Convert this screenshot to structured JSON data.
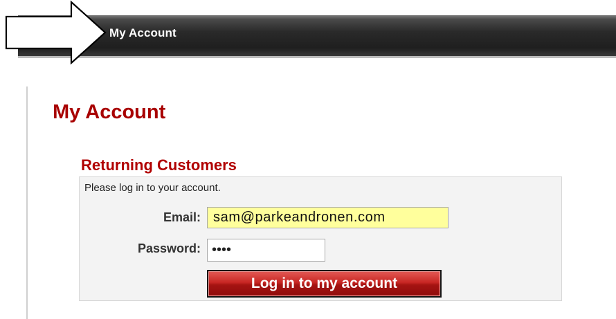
{
  "header": {
    "title": "My Account"
  },
  "page": {
    "title": "My Account"
  },
  "login": {
    "heading": "Returning Customers",
    "intro": "Please log in to your account.",
    "email_label": "Email:",
    "email_value": "sam@parkeandronen.com",
    "password_label": "Password:",
    "password_value": "••••",
    "submit_label": "Log in to my account"
  },
  "colors": {
    "accent_red": "#a80000",
    "email_field_bg": "#ffff9c",
    "header_bg": "#222222"
  },
  "icons": {
    "callout": "arrow-right-icon"
  }
}
